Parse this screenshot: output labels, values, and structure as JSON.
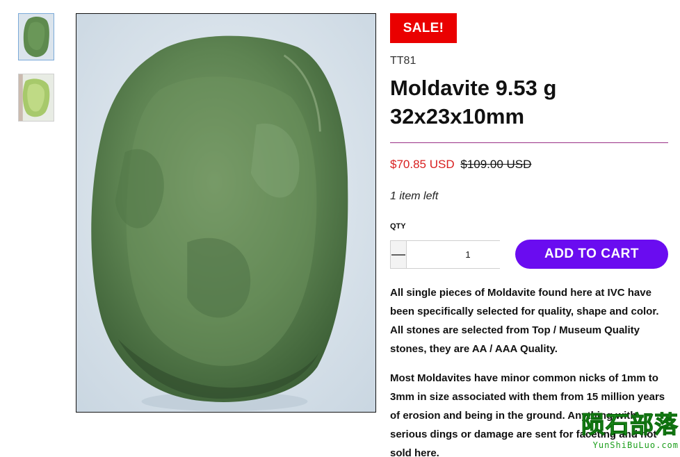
{
  "gallery": {
    "thumbnails": [
      {
        "alt": "Moldavite thumbnail 1"
      },
      {
        "alt": "Moldavite thumbnail 2"
      }
    ]
  },
  "product": {
    "sale_badge": "SALE!",
    "sku": "TT81",
    "title": "Moldavite 9.53 g 32x23x10mm",
    "price_sale": "$70.85 USD",
    "price_original": "$109.00 USD",
    "stock": "1 item left"
  },
  "purchase": {
    "qty_label": "QTY",
    "qty_value": "1",
    "add_to_cart": "ADD TO CART"
  },
  "description": [
    "All single pieces of Moldavite found here at IVC have been specifically selected for quality, shape and color. All stones are selected from Top / Museum Quality stones, they are AA / AAA Quality.",
    "Most Moldavites have minor common nicks of 1mm to 3mm in size associated with them from 15 million years of erosion and being in the ground. Anything with serious dings or damage are sent for faceting and not sold here."
  ],
  "watermark": {
    "main": "陨石部落",
    "sub": "YunShiBuLuo.com"
  },
  "colors": {
    "sale_badge": "#ea0000",
    "sale_price": "#d81f1f",
    "add_to_cart": "#6a0cf0",
    "divider": "#9a2f86"
  }
}
